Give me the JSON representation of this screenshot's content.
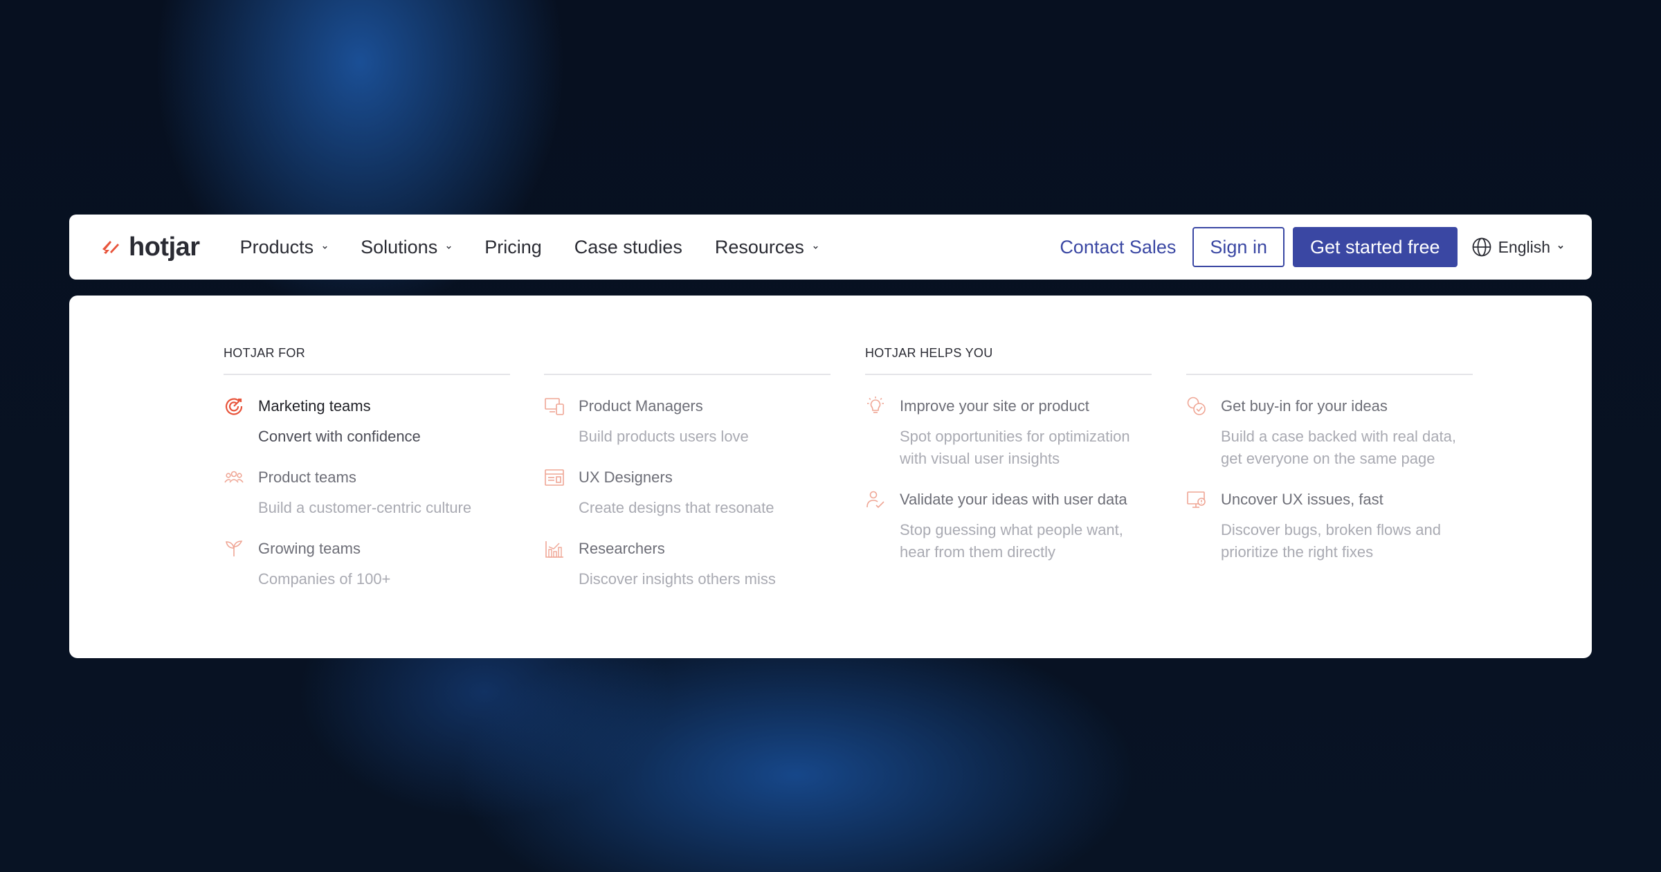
{
  "logo": {
    "text": "hotjar"
  },
  "nav": {
    "items": [
      {
        "label": "Products",
        "dropdown": true
      },
      {
        "label": "Solutions",
        "dropdown": true
      },
      {
        "label": "Pricing",
        "dropdown": false
      },
      {
        "label": "Case studies",
        "dropdown": false
      },
      {
        "label": "Resources",
        "dropdown": true
      }
    ],
    "contact_sales": "Contact Sales",
    "sign_in": "Sign in",
    "get_started": "Get started free",
    "language": "English"
  },
  "menu": {
    "section_for": "HOTJAR FOR",
    "section_helps": "HOTJAR HELPS YOU",
    "teams": [
      {
        "title": "Marketing teams",
        "desc": "Convert with confidence",
        "icon": "target-icon"
      },
      {
        "title": "Product teams",
        "desc": "Build a customer-centric culture",
        "icon": "people-icon"
      },
      {
        "title": "Growing teams",
        "desc": "Companies of 100+",
        "icon": "sprout-icon"
      }
    ],
    "roles": [
      {
        "title": "Product Managers",
        "desc": "Build products users love",
        "icon": "devices-icon"
      },
      {
        "title": "UX Designers",
        "desc": "Create designs that resonate",
        "icon": "layout-icon"
      },
      {
        "title": "Researchers",
        "desc": "Discover insights others miss",
        "icon": "bar-chart-icon"
      }
    ],
    "helps_left": [
      {
        "title": "Improve your site or product",
        "desc": "Spot opportunities for optimization with visual user insights",
        "icon": "lightbulb-icon"
      },
      {
        "title": "Validate your ideas with user data",
        "desc": "Stop guessing what people want, hear from them directly",
        "icon": "user-check-icon"
      }
    ],
    "helps_right": [
      {
        "title": "Get buy-in for your ideas",
        "desc": "Build a case backed with real data, get everyone on the same page",
        "icon": "check-badge-icon"
      },
      {
        "title": "Uncover UX issues, fast",
        "desc": "Discover bugs, broken flows and prioritize the right fixes",
        "icon": "monitor-bug-icon"
      }
    ]
  },
  "colors": {
    "brand": "#3a47a3",
    "accent": "#e8543b",
    "icon_faded": "#efa594"
  }
}
